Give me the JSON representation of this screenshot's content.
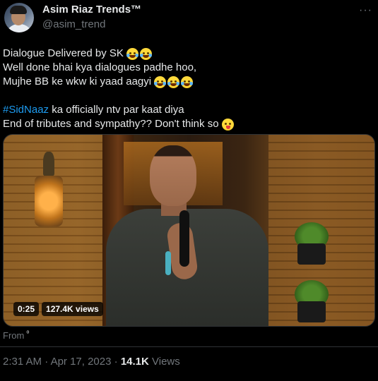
{
  "author": {
    "display_name": "Asim Riaz Trends™",
    "handle": "@asim_trend",
    "more_icon": "more-horizontal-icon"
  },
  "tweet": {
    "line1": "Dialogue Delivered by SK",
    "line2": "Well done bhai kya dialogues padhe hoo,",
    "line3": "Mujhe BB ke wkw ki yaad aagyi",
    "hashtag": "#SidNaaz",
    "line4_rest": " ka officially ntv par kaat diya",
    "line5": "End of tributes and sympathy?? Don't think so",
    "emojis": {
      "line1": [
        "rofl-emoji",
        "rofl-emoji"
      ],
      "line3": [
        "joy-emoji",
        "joy-emoji",
        "joy-emoji"
      ],
      "line5": [
        "winking-tongue-emoji"
      ]
    }
  },
  "video": {
    "duration": "0:25",
    "views": "127.4K views"
  },
  "from_label": "From",
  "meta": {
    "time": "2:31 AM",
    "separator": "·",
    "date": "Apr 17, 2023",
    "views_count": "14.1K",
    "views_label": "Views"
  }
}
